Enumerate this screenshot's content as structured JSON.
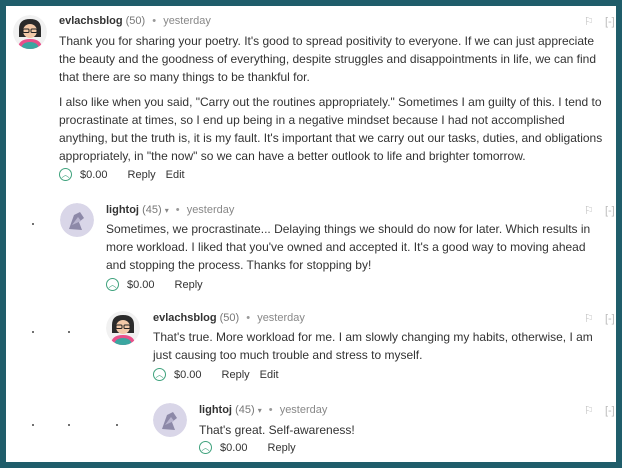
{
  "comments": [
    {
      "author": "evlachsblog",
      "rep": "(50)",
      "time": "yesterday",
      "paragraphs": [
        "Thank you for sharing your poetry. It's good to spread positivity to everyone. If we can just appreciate the beauty and the goodness of everything, despite struggles and disappointments in life, we can find that there are so many things to be thankful for.",
        "I also like when you said, \"Carry out the routines appropriately.\" Sometimes I am guilty of this. I tend to procrastinate at times, so I end up being in a negative mindset because I had not accomplished anything, but the truth is, it is my fault. It's important that we carry out our tasks, duties, and obligations appropriately, in \"the now\" so we can have a better outlook to life and brighter tomorrow."
      ],
      "payout": "$0.00",
      "reply": "Reply",
      "edit": "Edit"
    },
    {
      "author": "lightoj",
      "rep": "(45)",
      "time": "yesterday",
      "paragraphs": [
        "Sometimes, we procrastinate... Delaying things we should do now for later. Which results in more workload. I liked that you've owned and accepted it. It's a good way to moving ahead and stopping the process. Thanks for stopping by!"
      ],
      "payout": "$0.00",
      "reply": "Reply"
    },
    {
      "author": "evlachsblog",
      "rep": "(50)",
      "time": "yesterday",
      "paragraphs": [
        "That's true. More workload for me. I am slowly changing my habits, otherwise, I am just causing too much trouble and stress to myself."
      ],
      "payout": "$0.00",
      "reply": "Reply",
      "edit": "Edit"
    },
    {
      "author": "lightoj",
      "rep": "(45)",
      "time": "yesterday",
      "paragraphs": [
        "That's great. Self-awareness!"
      ],
      "payout": "$0.00",
      "reply": "Reply"
    }
  ],
  "icons": {
    "flag": "flag-icon",
    "collapse": "[-]",
    "upvote": "upvote-icon",
    "caret": "▾"
  },
  "colors": {
    "frame": "#1f5d6a",
    "upvote": "#3fa27d"
  }
}
